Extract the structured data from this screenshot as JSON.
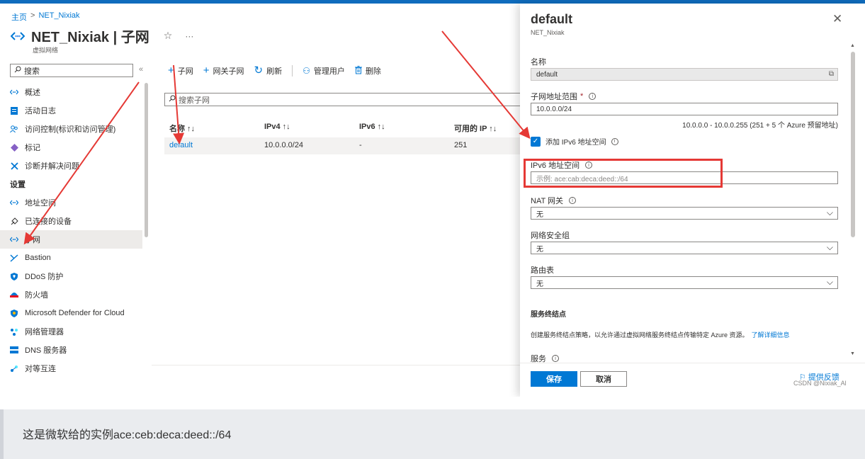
{
  "breadcrumb": {
    "home": "主页",
    "separator": ">",
    "current": "NET_Nixiak"
  },
  "page": {
    "title": "NET_Nixiak | 子网",
    "subtitle": "虚拟网络",
    "star_icon": "star-icon",
    "more": "···"
  },
  "sidebar": {
    "search_placeholder": "搜索",
    "collapse": "«",
    "items_top": [
      {
        "label": "概述",
        "icon": "network-icon",
        "color": "#0078d4"
      },
      {
        "label": "活动日志",
        "icon": "log-icon",
        "color": "#0078d4"
      },
      {
        "label": "访问控制(标识和访问管理)",
        "icon": "people-icon",
        "color": "#0078d4"
      },
      {
        "label": "标记",
        "icon": "tag-icon",
        "color": "#8661c5"
      },
      {
        "label": "诊断并解决问题",
        "icon": "wrench-icon",
        "color": "#0078d4"
      }
    ],
    "section_settings": "设置",
    "items_settings": [
      {
        "label": "地址空间",
        "icon": "network-icon",
        "color": "#0078d4",
        "active": false
      },
      {
        "label": "已连接的设备",
        "icon": "plug-icon",
        "color": "#323130",
        "active": false
      },
      {
        "label": "子网",
        "icon": "network-icon",
        "color": "#0078d4",
        "active": true
      },
      {
        "label": "Bastion",
        "icon": "bastion-icon",
        "color": "#0078d4",
        "active": false
      },
      {
        "label": "DDoS 防护",
        "icon": "shield-icon",
        "color": "#0078d4",
        "active": false
      },
      {
        "label": "防火墙",
        "icon": "firewall-icon",
        "color": "#e81123",
        "active": false
      },
      {
        "label": "Microsoft Defender for Cloud",
        "icon": "defender-icon",
        "color": "#0078d4",
        "active": false
      },
      {
        "label": "网络管理器",
        "icon": "manager-icon",
        "color": "#0078d4",
        "active": false
      },
      {
        "label": "DNS 服务器",
        "icon": "dns-icon",
        "color": "#0078d4",
        "active": false
      },
      {
        "label": "对等互连",
        "icon": "peering-icon",
        "color": "#0078d4",
        "active": false
      }
    ]
  },
  "toolbar": {
    "add_subnet": "子网",
    "add_gateway_subnet": "网关子网",
    "refresh": "刷新",
    "manage_users": "管理用户",
    "delete": "删除"
  },
  "list": {
    "search_placeholder": "搜索子网",
    "columns": [
      "名称 ↑↓",
      "IPv4 ↑↓",
      "IPv6 ↑↓",
      "可用的 IP ↑↓"
    ],
    "rows": [
      {
        "name": "default",
        "ipv4": "10.0.0.0/24",
        "ipv6": "-",
        "available": "251"
      }
    ]
  },
  "panel": {
    "title": "default",
    "subtitle": "NET_Nixiak",
    "close": "✕",
    "name_label": "名称",
    "name_value": "default",
    "range_label": "子网地址范围",
    "required_mark": "*",
    "range_value": "10.0.0.0/24",
    "range_hint": "10.0.0.0 - 10.0.0.255 (251 + 5 个 Azure 预留地址)",
    "ipv6_checkbox_label": "添加 IPv6 地址空间",
    "ipv6_label": "IPv6 地址空间",
    "ipv6_placeholder": "示例: ace:cab:deca:deed::/64",
    "nat_label": "NAT 网关",
    "nat_value": "无",
    "nsg_label": "网络安全组",
    "nsg_value": "无",
    "route_label": "路由表",
    "route_value": "无",
    "service_endpoints_title": "服务终结点",
    "service_endpoints_desc": "创建服务终结点策略，以允许通过虚拟网络服务终结点传输特定 Azure 资源。",
    "learn_more": "了解详细信息",
    "services_label": "服务",
    "save": "保存",
    "cancel": "取消",
    "feedback": "提供反馈",
    "watermark": "CSDN @Nixiak_Al"
  },
  "caption": "这是微软给的实例ace:ceb:deca:deed::/64",
  "colors": {
    "accent": "#0078d4",
    "annotation": "#e53935",
    "caption_bg": "#eaecef"
  }
}
